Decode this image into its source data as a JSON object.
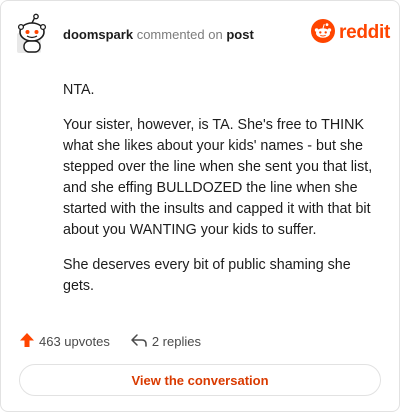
{
  "comment": {
    "username": "doomspark",
    "action_text": "commented on",
    "post_link": "post",
    "paragraphs": [
      "NTA.",
      "Your sister, however, is TA. She's free to THINK what she likes about your kids' names - but she stepped over the line when she sent you that list, and she effing BULLDOZED the line when she started with the insults and capped it with that bit about you WANTING your kids to suffer.",
      "She deserves every bit of public shaming she gets."
    ]
  },
  "brand": {
    "wordmark": "reddit",
    "color": "#ff4500"
  },
  "footer": {
    "upvotes": "463 upvotes",
    "replies": "2 replies"
  },
  "cta": {
    "label": "View the conversation"
  },
  "icons": [
    "snoo-avatar-icon",
    "reddit-logo-icon",
    "upvote-arrow-icon",
    "reply-arrow-icon"
  ]
}
